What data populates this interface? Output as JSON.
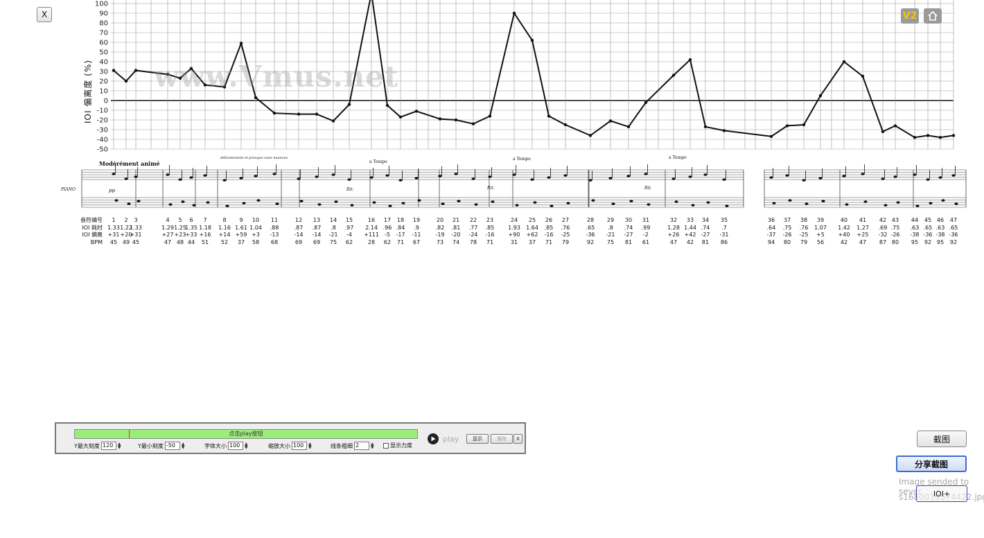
{
  "top": {
    "close_label": "X",
    "v2_label": "V2",
    "home_icon": "home-icon"
  },
  "chart_data": {
    "type": "line",
    "ylabel": "IOI 偏离度 (%)",
    "ylim": [
      -50,
      100
    ],
    "yticks": [
      100,
      90,
      80,
      70,
      60,
      50,
      40,
      30,
      20,
      10,
      0,
      -10,
      -20,
      -30,
      -40,
      -50
    ],
    "watermark": "www.Vmus.net",
    "grid": true,
    "x": [
      1,
      2,
      3,
      4,
      5,
      6,
      7,
      8,
      9,
      10,
      11,
      12,
      13,
      14,
      15,
      16,
      17,
      18,
      19,
      20,
      21,
      22,
      23,
      24,
      25,
      26,
      27,
      28,
      29,
      30,
      31,
      32,
      33,
      34,
      35,
      36,
      37,
      38,
      39,
      40,
      41,
      42,
      43,
      44,
      45,
      46,
      47
    ],
    "values": [
      31,
      20,
      31,
      27,
      23,
      33,
      16,
      14,
      59,
      3,
      -13,
      -14,
      -14,
      -21,
      -4,
      111,
      -5,
      -17,
      -11,
      -19,
      -20,
      -24,
      -16,
      90,
      62,
      -16,
      -25,
      -36,
      -21,
      -27,
      -2,
      26,
      42,
      -27,
      -31,
      -37,
      -26,
      -25,
      5,
      40,
      25,
      -32,
      -26,
      -38,
      -36,
      -38,
      -36
    ]
  },
  "score": {
    "tempo": "Modérément animé",
    "instrument": "PIANO",
    "atempo": "a Tempo",
    "rit": "Rit.",
    "dyn": "pp",
    "expression": "délicatement et presque sans nuances"
  },
  "table": {
    "row_labels": [
      "音符编号",
      "IOI 耗时",
      "IOI 偏离",
      "BPM"
    ],
    "columns": [
      [
        "1",
        "1.33",
        "+31",
        "45"
      ],
      [
        "2",
        "1.22",
        "+20",
        "49"
      ],
      [
        "3",
        "1.33",
        "+31",
        "45"
      ],
      [
        "4",
        "1.29",
        "+27",
        "47"
      ],
      [
        "5",
        "1.25",
        "+23",
        "48"
      ],
      [
        "6",
        "1.35",
        "+33",
        "44"
      ],
      [
        "7",
        "1.18",
        "+16",
        "51"
      ],
      [
        "8",
        "1.16",
        "+14",
        "52"
      ],
      [
        "9",
        "1.61",
        "+59",
        "37"
      ],
      [
        "10",
        "1.04",
        "+3",
        "58"
      ],
      [
        "11",
        ".88",
        "-13",
        "68"
      ],
      [
        "12",
        ".87",
        "-14",
        "69"
      ],
      [
        "13",
        ".87",
        "-14",
        "69"
      ],
      [
        "14",
        ".8",
        "-21",
        "75"
      ],
      [
        "15",
        ".97",
        "-4",
        "62"
      ],
      [
        "16",
        "2.14",
        "+111",
        "28"
      ],
      [
        "17",
        ".96",
        "-5",
        "62"
      ],
      [
        "18",
        ".84",
        "-17",
        "71"
      ],
      [
        "19",
        ".9",
        "-11",
        "67"
      ],
      [
        "20",
        ".82",
        "-19",
        "73"
      ],
      [
        "21",
        ".81",
        "-20",
        "74"
      ],
      [
        "22",
        ".77",
        "-24",
        "78"
      ],
      [
        "23",
        ".85",
        "-16",
        "71"
      ],
      [
        "24",
        "1.93",
        "+90",
        "31"
      ],
      [
        "25",
        "1.64",
        "+62",
        "37"
      ],
      [
        "26",
        ".85",
        "-16",
        "71"
      ],
      [
        "27",
        ".76",
        "-25",
        "79"
      ],
      [
        "28",
        ".65",
        "-36",
        "92"
      ],
      [
        "29",
        ".8",
        "-21",
        "75"
      ],
      [
        "30",
        ".74",
        "-27",
        "81"
      ],
      [
        "31",
        ".99",
        "-2",
        "61"
      ],
      [
        "32",
        "1.28",
        "+26",
        "47"
      ],
      [
        "33",
        "1.44",
        "+42",
        "42"
      ],
      [
        "34",
        ".74",
        "-27",
        "81"
      ],
      [
        "35",
        ".7",
        "-31",
        "86"
      ],
      [
        "36",
        ".64",
        "-37",
        "94"
      ],
      [
        "37",
        ".75",
        "-26",
        "80"
      ],
      [
        "38",
        ".76",
        "-25",
        "79"
      ],
      [
        "39",
        "1.07",
        "+5",
        "56"
      ],
      [
        "40",
        "1.42",
        "+40",
        "42"
      ],
      [
        "41",
        "1.27",
        "+25",
        "47"
      ],
      [
        "42",
        ".69",
        "-32",
        "87"
      ],
      [
        "43",
        ".75",
        "-26",
        "80"
      ],
      [
        "44",
        ".63",
        "-38",
        "95"
      ],
      [
        "45",
        ".65",
        "-36",
        "92"
      ],
      [
        "46",
        ".63",
        "-38",
        "95"
      ],
      [
        "47",
        ".65",
        "-36",
        "92"
      ]
    ]
  },
  "panel": {
    "progress_text": "点击play按钮",
    "ymax_label": "Y最大刻度",
    "ymax_value": "120",
    "ymin_label": "Y最小刻度",
    "ymin_value": "-50",
    "font_label": "字体大小",
    "font_value": "100",
    "zoom_label": "缩放大小",
    "zoom_value": "100",
    "line_label": "线条粗细",
    "line_value": "2",
    "dyn_label": "显示力度",
    "play_label": "play",
    "show_label": "显示",
    "save_label": "保存",
    "close_label": "X"
  },
  "right": {
    "screenshot_label": "截图",
    "share_label": "分享截图",
    "sent_line1": "Image sended to sever",
    "sent_line2": "s1680018574422.jpg",
    "ioi_label": "IOI+"
  }
}
